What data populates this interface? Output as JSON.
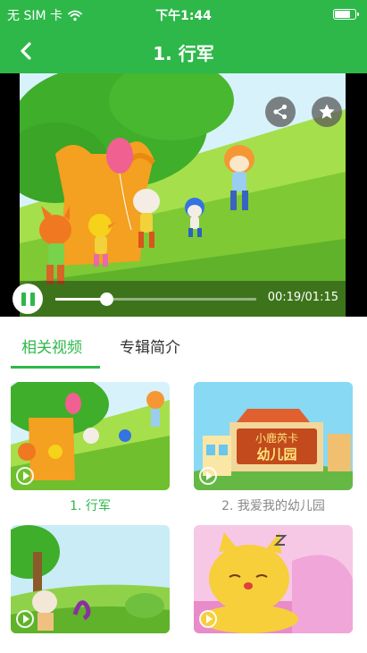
{
  "status_bar": {
    "carrier": "无 SIM 卡",
    "time": "下午1:44",
    "battery_level": 0.85,
    "wifi_icon": "wifi-icon",
    "battery_icon": "battery-icon"
  },
  "nav": {
    "back_icon": "chevron-left-icon",
    "title": "1. 行军"
  },
  "player": {
    "share_icon": "share-icon",
    "favorite_icon": "star-icon",
    "pause_icon": "pause-icon",
    "time_display": "00:19/01:15",
    "progress": 0.253
  },
  "tabs": [
    {
      "label": "相关视频",
      "active": true
    },
    {
      "label": "专辑简介",
      "active": false
    }
  ],
  "videos": [
    {
      "title": "1. 行军",
      "active": true
    },
    {
      "title": "2. 我爱我的幼儿园",
      "active": false,
      "sign_top": "小鹿芮卡",
      "sign_bottom": "幼儿园"
    },
    {
      "title": "",
      "active": false
    },
    {
      "title": "",
      "active": false
    }
  ],
  "colors": {
    "primary_green": "#2eb84a",
    "text_dark": "#333333",
    "text_gray": "#888888"
  }
}
